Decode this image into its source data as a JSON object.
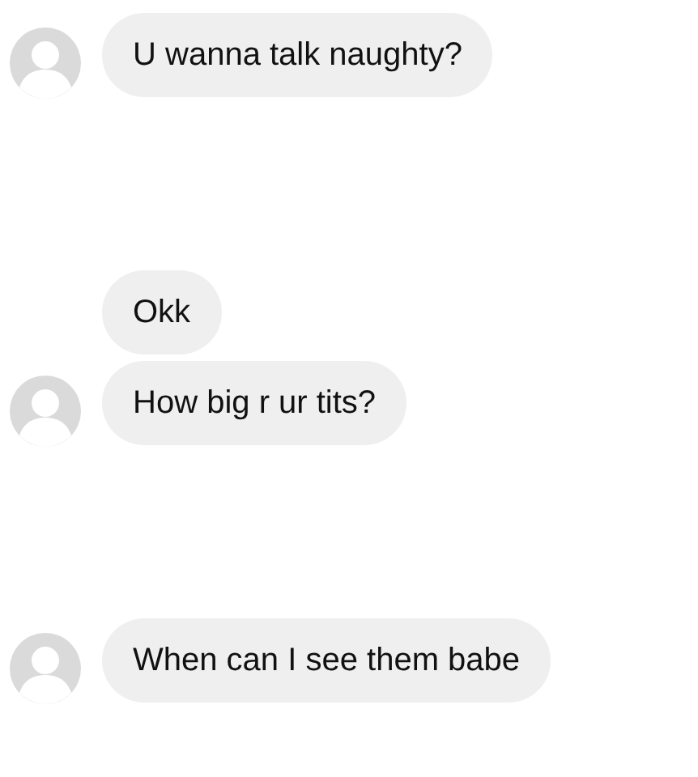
{
  "message_groups": [
    {
      "messages": [
        "U wanna talk naughty?"
      ]
    },
    {
      "messages": [
        "Okk",
        "How big r ur tits?"
      ]
    },
    {
      "messages": [
        "When can I see them babe"
      ]
    }
  ]
}
